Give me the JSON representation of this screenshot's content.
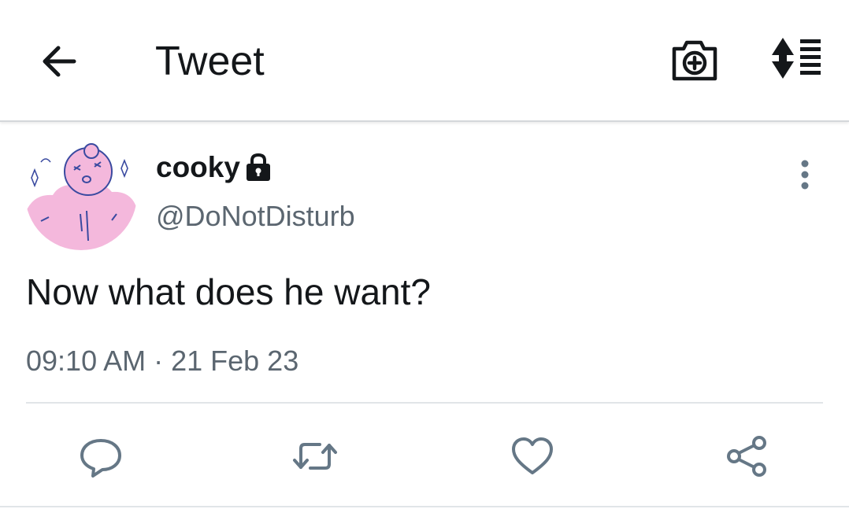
{
  "topbar": {
    "title": "Tweet",
    "back_icon": "arrow-left-icon",
    "camera_icon": "camera-plus-icon",
    "sort_icon": "sort-list-icon"
  },
  "tweet": {
    "author": {
      "display_name": "cooky",
      "handle": "@DoNotDisturb",
      "protected": true,
      "avatar": "pink-cartoon-avatar"
    },
    "text": "Now what does he want?",
    "time": "09:10 AM",
    "date": "21 Feb 23",
    "timestamp": "09:10 AM · 21 Feb 23"
  },
  "actions": [
    {
      "name": "reply",
      "icon": "reply-icon"
    },
    {
      "name": "retweet",
      "icon": "retweet-icon"
    },
    {
      "name": "like",
      "icon": "heart-icon"
    },
    {
      "name": "share",
      "icon": "share-icon"
    }
  ],
  "colors": {
    "text_primary": "#14171a",
    "text_secondary": "#5b6670",
    "icon_gray": "#657786",
    "divider": "#e1e5e8",
    "avatar_pink": "#f4b8dc"
  }
}
